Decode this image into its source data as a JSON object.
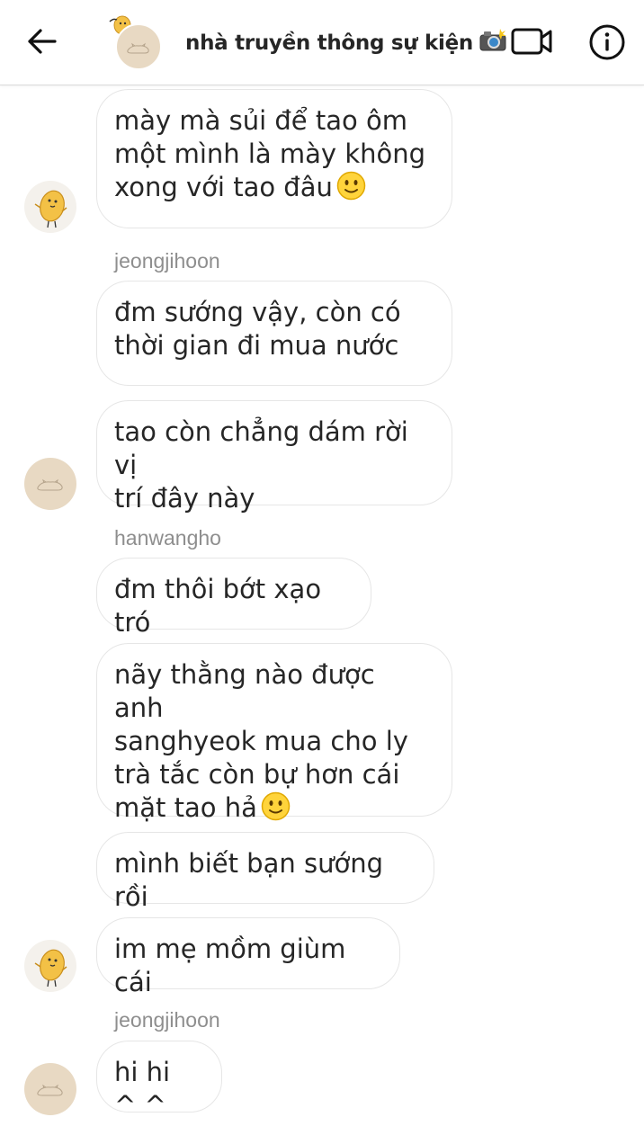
{
  "header": {
    "title": "nhà truyền thông sự kiện",
    "title_emoji": "📸"
  },
  "messages": [
    {
      "text": "mày mà sủi để tao ôm\nmột mình là mày không\nxong với tao đâu",
      "emoji": "🙂"
    },
    {
      "sender": "jeongjihoon"
    },
    {
      "text": "đm sướng vậy, còn có\nthời gian đi mua nước"
    },
    {
      "text": "tao còn chẳng dám rời vị\ntrí đây này"
    },
    {
      "sender": "hanwangho"
    },
    {
      "text": "đm thôi bớt xạo tró"
    },
    {
      "text": "nãy thằng nào được anh\nsanghyeok mua cho ly\ntrà tắc còn bự hơn cái\nmặt tao hả",
      "emoji": "🙂"
    },
    {
      "text": "mình biết bạn sướng rồi"
    },
    {
      "text": "im mẹ mồm giùm cái"
    },
    {
      "sender": "jeongjihoon"
    },
    {
      "text": "hi hi ^ ^"
    }
  ],
  "colors": {
    "bubble_border": "#e6e6e6",
    "sender_gray": "#8e8e8e",
    "potato": "#f3c146",
    "cat_avatar_bg": "#e8d9c3"
  },
  "icons": [
    "back-arrow-icon",
    "video-camera-icon",
    "info-icon",
    "smile-emoji-icon",
    "camera-flash-emoji-icon"
  ]
}
